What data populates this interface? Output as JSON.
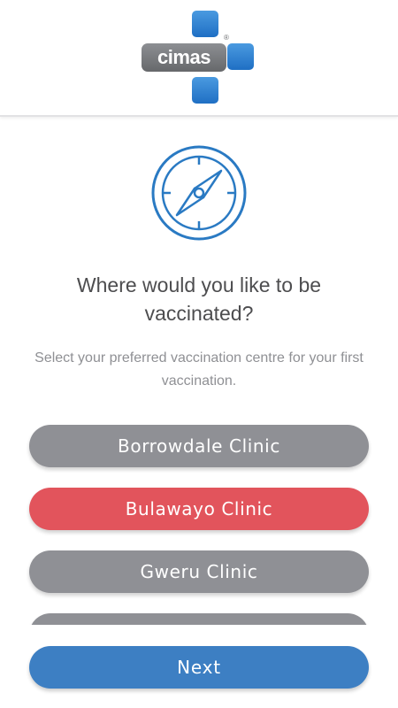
{
  "header": {
    "logo_text": "cimas",
    "logo_mark": "®",
    "logo_icon": "cimas-cross-logo"
  },
  "hero": {
    "icon": "compass-icon",
    "accent_color": "#2a7ac3"
  },
  "title": "Where would you like to be vaccinated?",
  "subtitle": "Select your preferred vaccination centre for your first vaccination.",
  "clinics": [
    {
      "label": "Borrowdale Clinic",
      "selected": false
    },
    {
      "label": "Bulawayo Clinic",
      "selected": true
    },
    {
      "label": "Gweru Clinic",
      "selected": false
    },
    {
      "label": "",
      "selected": false
    }
  ],
  "colors": {
    "option_default": "#8f9095",
    "option_selected": "#e2545c",
    "primary": "#3d7fc3"
  },
  "next_button": {
    "label": "Next"
  }
}
